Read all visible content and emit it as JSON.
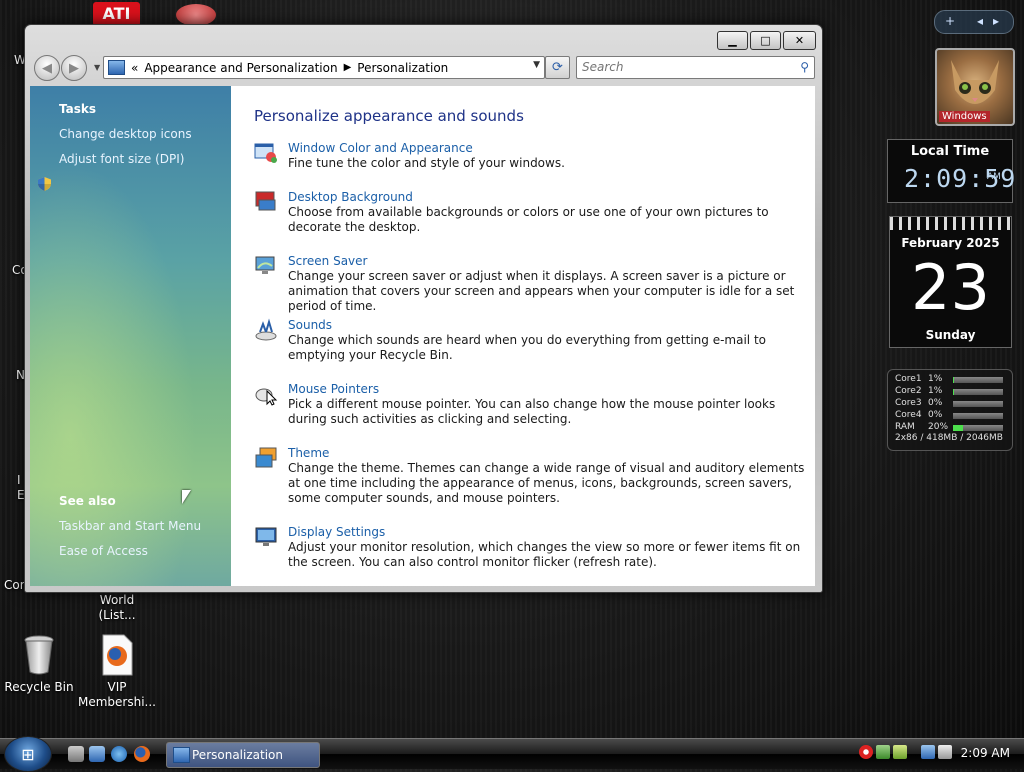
{
  "desktop": {
    "icons": [
      {
        "label": "World (List...",
        "id": "world"
      },
      {
        "label": "Recycle Bin",
        "id": "recycle"
      },
      {
        "label": "VIP Membershi...",
        "id": "vip"
      }
    ],
    "clipped": [
      "W",
      "Co",
      "N",
      "I",
      "E",
      "Cor"
    ]
  },
  "window": {
    "address": {
      "root": "«",
      "crumbs": [
        "Appearance and Personalization",
        "Personalization"
      ]
    },
    "search": {
      "placeholder": "Search"
    },
    "controls": {
      "minimize": "▁",
      "maximize": "□",
      "close": "✕"
    }
  },
  "sidebar": {
    "tasks_heading": "Tasks",
    "tasks": [
      "Change desktop icons",
      "Adjust font size (DPI)"
    ],
    "see_also_heading": "See also",
    "see_also": [
      "Taskbar and Start Menu",
      "Ease of Access"
    ]
  },
  "content": {
    "heading": "Personalize appearance and sounds",
    "items": [
      {
        "title": "Window Color and Appearance",
        "desc": "Fine tune the color and style of your windows.",
        "icon": "window-color-icon"
      },
      {
        "title": "Desktop Background",
        "desc": "Choose from available backgrounds or colors or use one of your own pictures to decorate the desktop.",
        "icon": "desktop-background-icon"
      },
      {
        "title": "Screen Saver",
        "desc": "Change your screen saver or adjust when it displays. A screen saver is a picture or animation that covers your screen and appears when your computer is idle for a set period of time.",
        "icon": "screen-saver-icon"
      },
      {
        "title": "Sounds",
        "desc": "Change which sounds are heard when you do everything from getting e-mail to emptying your Recycle Bin.",
        "icon": "sounds-icon"
      },
      {
        "title": "Mouse Pointers",
        "desc": "Pick a different mouse pointer. You can also change how the mouse pointer looks during such activities as clicking and selecting.",
        "icon": "mouse-pointers-icon"
      },
      {
        "title": "Theme",
        "desc": "Change the theme. Themes can change a wide range of visual and auditory elements at one time including the appearance of menus, icons, backgrounds, screen savers, some computer sounds, and mouse pointers.",
        "icon": "theme-icon"
      },
      {
        "title": "Display Settings",
        "desc": "Adjust your monitor resolution, which changes the view so more or fewer items fit on the screen. You can also control monitor flicker (refresh rate).",
        "icon": "display-settings-icon"
      }
    ]
  },
  "gadgets": {
    "controls": {
      "add": "+",
      "prev": "◂",
      "next": "▸"
    },
    "photo_badge": "Windows",
    "clock": {
      "title": "Local Time",
      "time": "2:09:59",
      "ampm": "AM"
    },
    "calendar": {
      "month": "February 2025",
      "day": "23",
      "weekday": "Sunday"
    },
    "meter": {
      "rows": [
        {
          "name": "Core1",
          "value": "1%",
          "level": 0.01
        },
        {
          "name": "Core2",
          "value": "1%",
          "level": 0.01
        },
        {
          "name": "Core3",
          "value": "0%",
          "level": 0.0
        },
        {
          "name": "Core4",
          "value": "0%",
          "level": 0.0
        },
        {
          "name": "RAM",
          "value": "20%",
          "level": 0.2
        }
      ],
      "footer": "2x86 / 418MB / 2046MB"
    }
  },
  "taskbar": {
    "task": "Personalization",
    "time": "2:09 AM"
  },
  "colors": {
    "link": "#1b5fa8",
    "heading": "#1e3287"
  }
}
